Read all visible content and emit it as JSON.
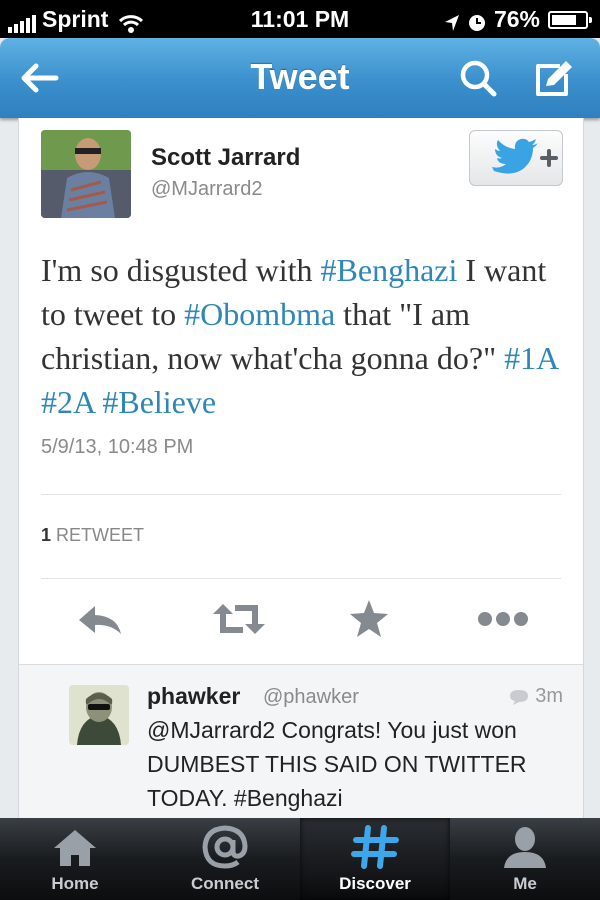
{
  "status_bar": {
    "carrier": "Sprint",
    "time": "11:01 PM",
    "battery_percent": "76%",
    "battery_level": 0.76
  },
  "nav": {
    "title": "Tweet"
  },
  "tweet": {
    "author_name": "Scott Jarrard",
    "author_handle": "@MJarrard2",
    "text_segments": [
      {
        "text": "I'm so disgusted with ",
        "hashtag": false
      },
      {
        "text": "#Benghazi",
        "hashtag": true
      },
      {
        "text": " I want to tweet to ",
        "hashtag": false
      },
      {
        "text": "#Obombma",
        "hashtag": true
      },
      {
        "text": " that \"I am christian, now what'cha gonna do?\" ",
        "hashtag": false
      },
      {
        "text": "#1A",
        "hashtag": true
      },
      {
        "text": " ",
        "hashtag": false
      },
      {
        "text": "#2A",
        "hashtag": true
      },
      {
        "text": " ",
        "hashtag": false
      },
      {
        "text": "#Believe",
        "hashtag": true
      }
    ],
    "date": "5/9/13, 10:48 PM",
    "retweet_count": "1",
    "retweet_label": "RETWEET"
  },
  "reply": {
    "name": "phawker",
    "handle": "@phawker",
    "time": "3m",
    "text": "@MJarrard2 Congrats! You just won DUMBEST THIS SAID ON TWITTER TODAY. #Benghazi"
  },
  "tabs": [
    {
      "label": "Home",
      "icon": "home-icon",
      "active": false
    },
    {
      "label": "Connect",
      "icon": "at-icon",
      "active": false
    },
    {
      "label": "Discover",
      "icon": "hash-icon",
      "active": true
    },
    {
      "label": "Me",
      "icon": "person-icon",
      "active": false
    }
  ],
  "colors": {
    "nav_blue": "#3a8fcc",
    "hashtag_blue": "#2f87b9",
    "tab_active": "#ffffff"
  }
}
